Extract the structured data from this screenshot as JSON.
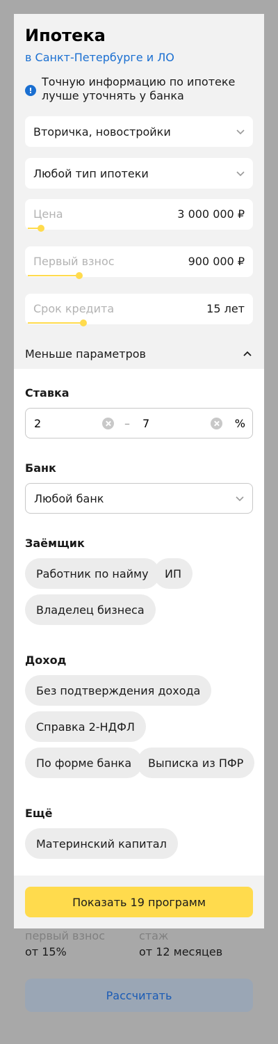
{
  "background": {
    "info": [
      {
        "label": "первый взнос",
        "value": "от 15%"
      },
      {
        "label": "стаж",
        "value": "от 12 месяцев"
      }
    ],
    "calc_button": "Рассчитать"
  },
  "modal": {
    "title": "Ипотека",
    "location_link": "в Санкт-Петербурге и ЛО",
    "notice_icon": "info-icon",
    "notice_text": "Точную информацию по ипотеке лучше уточнять у банка",
    "property_select": "Вторичка, новостройки",
    "mortgage_type_select": "Любой тип ипотеки",
    "price": {
      "label": "Цена",
      "value": "3 000 000 ₽",
      "slider_fraction": 0.06
    },
    "down_payment": {
      "label": "Первый взнос",
      "value": "900 000 ₽",
      "slider_fraction": 0.23
    },
    "term": {
      "label": "Срок кредита",
      "value": "15 лет",
      "slider_fraction": 0.25
    },
    "less_params": "Меньше параметров",
    "rate": {
      "title": "Ставка",
      "from": "2",
      "dash": "–",
      "to": "7",
      "unit": "%"
    },
    "bank": {
      "title": "Банк",
      "value": "Любой банк"
    },
    "borrower": {
      "title": "Заёмщик",
      "chips": [
        "Работник по найму",
        "ИП",
        "Владелец бизнеса"
      ]
    },
    "income": {
      "title": "Доход",
      "chips": [
        "Без подтверждения дохода",
        "Справка 2-НДФЛ",
        "По форме банка",
        "Выписка из ПФР"
      ]
    },
    "more": {
      "title": "Ещё",
      "chips": [
        "Материнский капитал"
      ]
    },
    "show_button": "Показать 19 программ"
  },
  "colors": {
    "accent_yellow": "#ffdb4d",
    "link_blue": "#1a6fd1",
    "modal_bg": "#f2f2f2",
    "overlay": "#a8a8a8"
  }
}
